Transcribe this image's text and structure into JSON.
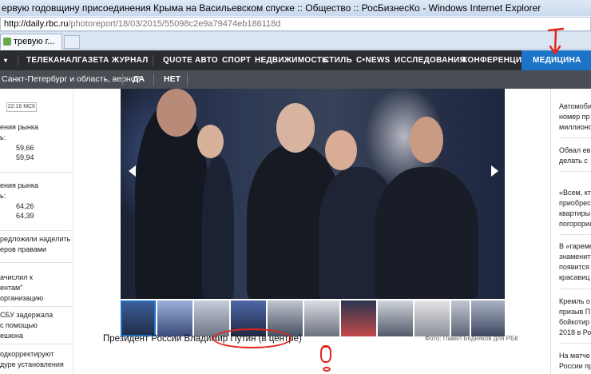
{
  "window": {
    "title": "ервую годовщину присоединения Крыма на Васильевском спуске :: Общество :: РосБизнесКо - Windows Internet Explorer"
  },
  "address_bar": {
    "host": "http://daily.rbc.ru",
    "path": "/photoreport/18/03/2015/55098c2e9a79474eb186118d"
  },
  "tab": {
    "label": "тревую г..."
  },
  "nav": {
    "menu_icon": "dropdown-caret-icon",
    "items": [
      "ТЕЛЕКАНАЛ",
      "ГАЗЕТА",
      "ЖУРНАЛ",
      "QUOTE",
      "АВТО",
      "СПОРТ",
      "НЕДВИЖИМОСТЬ",
      "СТИЛЬ",
      "C•NEWS",
      "ИССЛЕДОВАНИЯ",
      "КОНФЕРЕНЦИИ",
      "МЕДИЦИНА"
    ],
    "active": "МЕДИЦИНА",
    "active_color": "#1c74c9"
  },
  "poll": {
    "question": "Санкт-Петербург и область, верно?",
    "yes": "ДА",
    "no": "НЕТ"
  },
  "left_column": {
    "time": "22:16 МСК",
    "rates": [
      {
        "label_1": "ения рынка",
        "label_2": "ь:",
        "buy": "59,66",
        "sell": "59,94"
      },
      {
        "label_1": "ения рынка",
        "label_2": "ь:",
        "buy": "64,26",
        "sell": "64,39"
      }
    ],
    "news": [
      [
        "редложили наделить",
        "еров правами"
      ],
      [
        "ачислил к",
        "ентам\"",
        "организацию"
      ],
      [
        "СБУ задержала",
        "с помощью",
        "ешюна"
      ],
      [
        "одкорректируют",
        "дуре установления"
      ]
    ]
  },
  "right_column": {
    "news": [
      [
        "Автомоби",
        "номер пр",
        "миллионо"
      ],
      [
        "Обвал евр",
        "делать с"
      ],
      [
        "«Всем, кто",
        "приобрес",
        "квартиры",
        "погорорил"
      ],
      [
        "В «гареме",
        "знамениту",
        "появится",
        "красавиц"
      ],
      [
        "Кремль о",
        "призыв П",
        "бойкотир",
        "2018 в Ро"
      ],
      [
        "На матче",
        "России пр"
      ]
    ]
  },
  "photo": {
    "caption_prefix": "Президент России Владимир ",
    "caption_highlight": "Путин (в центре)",
    "credit": "Фото: Павел Бедняков для РБК",
    "prev_icon": "chevron-left-icon",
    "next_icon": "chevron-right-icon",
    "thumbnail_count": 11,
    "selected_thumbnail": 0,
    "annotation_color": "#e2231a"
  }
}
